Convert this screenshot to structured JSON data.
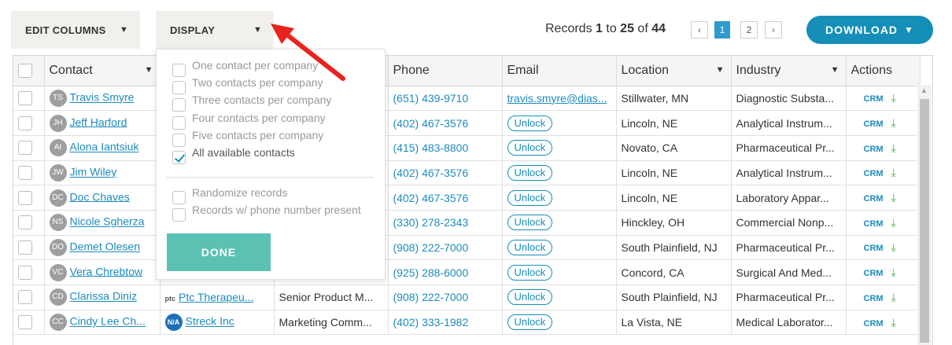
{
  "toolbar": {
    "edit_columns": "EDIT COLUMNS",
    "display": "DISPLAY",
    "records_prefix": "Records ",
    "records_from": "1",
    "records_to_word": " to ",
    "records_to": "25",
    "records_of_word": " of ",
    "records_total": "44",
    "pages": [
      "‹",
      "1",
      "2",
      "›"
    ],
    "current_page": 1,
    "download": "DOWNLOAD"
  },
  "table": {
    "headers": [
      "Contact",
      "",
      "",
      "Phone",
      "Email",
      "Location",
      "Industry",
      "Actions"
    ],
    "rows": [
      {
        "initials": "TS",
        "name": "Travis Smyre",
        "company": "",
        "title": "",
        "phone": "(651) 439-9710",
        "email": "travis.smyre@dias...",
        "email_locked": false,
        "location": "Stillwater, MN",
        "industry": "Diagnostic Substa..."
      },
      {
        "initials": "JH",
        "name": "Jeff Harford",
        "company": "",
        "title": "",
        "phone": "(402) 467-3576",
        "email": "Unlock",
        "email_locked": true,
        "location": "Lincoln, NE",
        "industry": "Analytical Instrum..."
      },
      {
        "initials": "AI",
        "name": "Alona Iantsiuk",
        "company": "",
        "title": "",
        "phone": "(415) 483-8800",
        "email": "Unlock",
        "email_locked": true,
        "location": "Novato, CA",
        "industry": "Pharmaceutical Pr..."
      },
      {
        "initials": "JW",
        "name": "Jim Wiley",
        "company": "",
        "title": "",
        "phone": "(402) 467-3576",
        "email": "Unlock",
        "email_locked": true,
        "location": "Lincoln, NE",
        "industry": "Analytical Instrum..."
      },
      {
        "initials": "DC",
        "name": "Doc Chaves",
        "company": "",
        "title": "",
        "phone": "(402) 467-3576",
        "email": "Unlock",
        "email_locked": true,
        "location": "Lincoln, NE",
        "industry": "Laboratory Appar..."
      },
      {
        "initials": "NS",
        "name": "Nicole Sgherza",
        "company": "",
        "title": "",
        "phone": "(330) 278-2343",
        "email": "Unlock",
        "email_locked": true,
        "location": "Hinckley, OH",
        "industry": "Commercial Nonp..."
      },
      {
        "initials": "DO",
        "name": "Demet Olesen",
        "company": "",
        "title": "",
        "phone": "(908) 222-7000",
        "email": "Unlock",
        "email_locked": true,
        "location": "South Plainfield, NJ",
        "industry": "Pharmaceutical Pr..."
      },
      {
        "initials": "VC",
        "name": "Vera Chrebtow",
        "company": "",
        "title": "",
        "phone": "(925) 288-6000",
        "email": "Unlock",
        "email_locked": true,
        "location": "Concord, CA",
        "industry": "Surgical And Med..."
      },
      {
        "initials": "CD",
        "name": "Clarissa Diniz",
        "company_logo": "ptc",
        "company": "Ptc Therapeu...",
        "title": "Senior Product M...",
        "phone": "(908) 222-7000",
        "email": "Unlock",
        "email_locked": true,
        "location": "South Plainfield, NJ",
        "industry": "Pharmaceutical Pr..."
      },
      {
        "initials": "CC",
        "name": "Cindy Lee Ch...",
        "company_logo": "N/A",
        "company": "Streck Inc",
        "title": "Marketing Comm...",
        "phone": "(402) 333-1982",
        "email": "Unlock",
        "email_locked": true,
        "location": "La Vista, NE",
        "industry": "Medical Laborator..."
      }
    ],
    "crm_label": "CRM"
  },
  "display_menu": {
    "options": [
      {
        "label": "One contact per company",
        "checked": false
      },
      {
        "label": "Two contacts per company",
        "checked": false
      },
      {
        "label": "Three contacts per company",
        "checked": false
      },
      {
        "label": "Four contacts per company",
        "checked": false
      },
      {
        "label": "Five contacts per company",
        "checked": false
      },
      {
        "label": "All available contacts",
        "checked": true
      }
    ],
    "filters": [
      {
        "label": "Randomize records",
        "checked": false
      },
      {
        "label": "Records w/ phone number present",
        "checked": false
      }
    ],
    "done": "DONE"
  },
  "colors": {
    "accent": "#158fb7",
    "done": "#5bc2b3",
    "arrow": "#e8231f"
  }
}
